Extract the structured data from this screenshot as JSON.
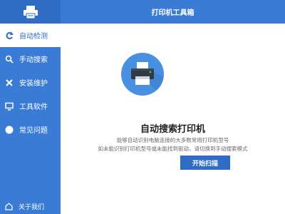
{
  "app": {
    "title": "打印机工具箱"
  },
  "sidebar": {
    "items": [
      {
        "label": "自动检测",
        "icon": "refresh-icon",
        "active": true
      },
      {
        "label": "手动搜索",
        "icon": "search-icon",
        "active": false
      },
      {
        "label": "安装维护",
        "icon": "tools-icon",
        "active": false
      },
      {
        "label": "工具软件",
        "icon": "monitor-icon",
        "active": false
      },
      {
        "label": "常见问题",
        "icon": "question-icon",
        "active": false
      }
    ],
    "about_label": "关于我们"
  },
  "main": {
    "headline": "自动搜索打印机",
    "description_line1": "能够自动识别电脑连接的大多数常用打印机型号",
    "description_line2": "如未能识别打印机型号或未能找到驱动，请切换到手动搜索模式",
    "start_button_label": "开始扫描"
  },
  "colors": {
    "sidebar": "#3a7bd5",
    "accent": "#2f6cc4",
    "circle": "#4a90e2"
  }
}
